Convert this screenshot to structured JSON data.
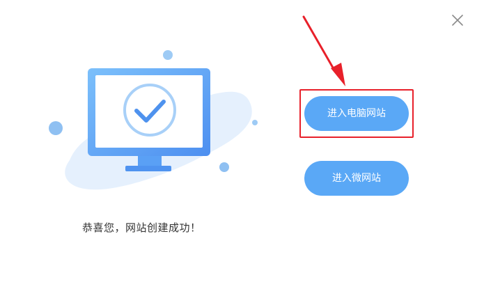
{
  "dialog": {
    "close_icon": "close-icon",
    "success_message": "恭喜您，网站创建成功！",
    "buttons": {
      "enter_pc_site": "进入电脑网站",
      "enter_micro_site": "进入微网站"
    }
  },
  "colors": {
    "button_bg": "#5aa8f6",
    "highlight_border": "#e8202a",
    "arrow": "#e8202a",
    "monitor_primary": "#5aa8f6"
  }
}
